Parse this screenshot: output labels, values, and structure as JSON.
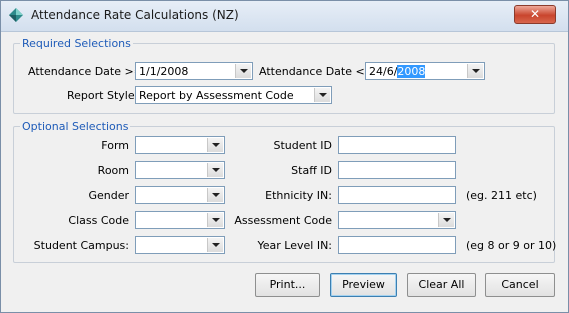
{
  "window": {
    "title": "Attendance Rate Calculations (NZ)",
    "close_label": "✕"
  },
  "required": {
    "legend": "Required Selections",
    "date_from_label": "Attendance Date >=",
    "date_from_value": "1/1/2008",
    "date_to_label": "Attendance Date <=",
    "date_to_value_prefix": "24/6/",
    "date_to_value_selected": "2008",
    "report_style_label": "Report Style",
    "report_style_value": "Report by Assessment Code"
  },
  "optional": {
    "legend": "Optional Selections",
    "form_label": "Form",
    "room_label": "Room",
    "gender_label": "Gender",
    "class_code_label": "Class Code",
    "student_campus_label": "Student Campus:",
    "student_id_label": "Student ID",
    "staff_id_label": "Staff ID",
    "ethnicity_label": "Ethnicity IN:",
    "ethnicity_hint": "(eg. 211 etc)",
    "assessment_code_label": "Assessment Code",
    "year_level_label": "Year Level IN:",
    "year_level_hint": "(eg 8 or 9 or 10)"
  },
  "buttons": {
    "print": "Print...",
    "preview": "Preview",
    "clear_all": "Clear All",
    "cancel": "Cancel"
  }
}
